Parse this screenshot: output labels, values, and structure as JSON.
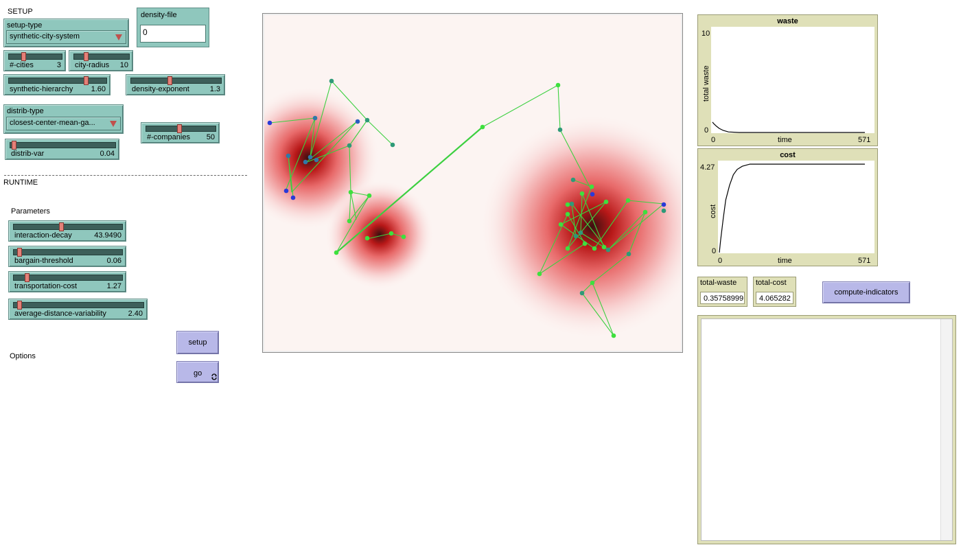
{
  "setup": {
    "section_label": "SETUP",
    "setup_type": {
      "label": "setup-type",
      "value": "synthetic-city-system"
    },
    "density_file": {
      "label": "density-file",
      "value": "0"
    },
    "cities": {
      "name": "#-cities",
      "value": "3",
      "fraction": 0.27
    },
    "city_radius": {
      "name": "city-radius",
      "value": "10",
      "fraction": 0.2
    },
    "synthetic_hierarchy": {
      "name": "synthetic-hierarchy",
      "value": "1.60",
      "fraction": 0.8
    },
    "density_exponent": {
      "name": "density-exponent",
      "value": "1.3",
      "fraction": 0.43
    },
    "distrib_type": {
      "label": "distrib-type",
      "value": "closest-center-mean-ga..."
    },
    "companies": {
      "name": "#-companies",
      "value": "50",
      "fraction": 0.48
    },
    "distrib_var": {
      "name": "distrib-var",
      "value": "0.04",
      "fraction": 0.02
    }
  },
  "runtime": {
    "section_label": "RUNTIME",
    "parameters_label": "Parameters",
    "options_label": "Options",
    "interaction_decay": {
      "name": "interaction-decay",
      "value": "43.9490",
      "fraction": 0.44
    },
    "bargain_threshold": {
      "name": "bargain-threshold",
      "value": "0.06",
      "fraction": 0.04
    },
    "transportation_cost": {
      "name": "transportation-cost",
      "value": "1.27",
      "fraction": 0.11
    },
    "average_distance_variability": {
      "name": "average-distance-variability",
      "value": "2.40",
      "fraction": 0.03
    },
    "setup_button": "setup",
    "go_button": "go",
    "forever_icon": "forever-icon"
  },
  "plots": {
    "waste": {
      "title": "waste",
      "ylabel": "total waste",
      "xlabel": "time",
      "ymax": "10",
      "ymin": "0",
      "xmin": "0",
      "xmax": "571"
    },
    "cost": {
      "title": "cost",
      "ylabel": "cost",
      "xlabel": "time",
      "ymax": "4.27",
      "ymin": "0",
      "xmin": "0",
      "xmax": "571"
    }
  },
  "monitors": {
    "total_waste": {
      "label": "total-waste",
      "value": "0.35758999"
    },
    "total_cost": {
      "label": "total-cost",
      "value": "4.065282"
    }
  },
  "compute_indicators_button": "compute-indicators",
  "colors": {
    "widget": "#8fc7bd",
    "button": "#b8b8e8",
    "monitor": "#dfe0b8",
    "link": "#3cd040",
    "agent_green": "#3ee03e",
    "agent_teal": "#2e9a78",
    "agent_blue": "#2a3ad8"
  },
  "chart_data": [
    {
      "type": "line",
      "title": "waste",
      "xlabel": "time",
      "ylabel": "total waste",
      "xlim": [
        0,
        571
      ],
      "ylim": [
        0,
        10
      ],
      "series": [
        {
          "x": [
            0,
            5,
            15,
            25,
            40,
            60,
            100,
            200,
            300,
            400,
            500,
            571
          ],
          "values": [
            1.0,
            0.85,
            0.6,
            0.4,
            0.2,
            0.05,
            0.0,
            0.0,
            0.0,
            0.0,
            0.0,
            0.0
          ]
        }
      ]
    },
    {
      "type": "line",
      "title": "cost",
      "xlabel": "time",
      "ylabel": "cost",
      "xlim": [
        0,
        571
      ],
      "ylim": [
        0,
        4.27
      ],
      "series": [
        {
          "x": [
            0,
            5,
            15,
            25,
            40,
            55,
            70,
            90,
            120,
            200,
            300,
            400,
            500,
            571
          ],
          "values": [
            0.0,
            0.6,
            1.6,
            2.5,
            3.2,
            3.7,
            3.95,
            4.1,
            4.2,
            4.2,
            4.2,
            4.2,
            4.2,
            4.2
          ]
        }
      ]
    }
  ]
}
